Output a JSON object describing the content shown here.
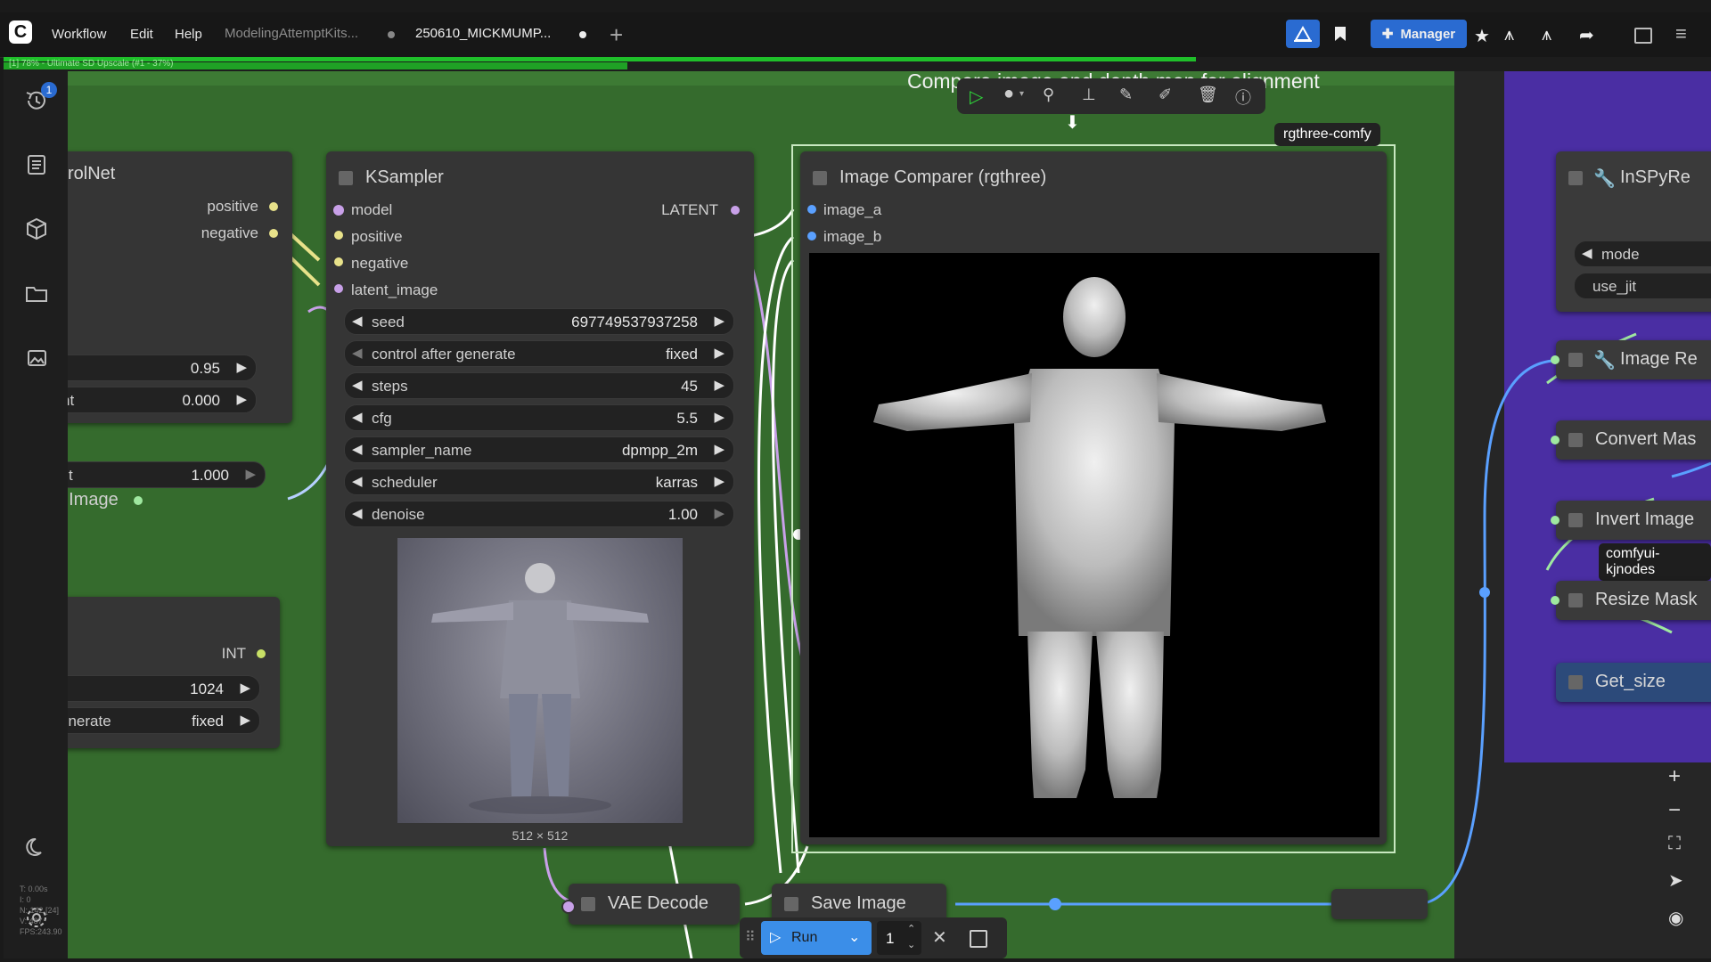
{
  "app": {
    "logo": "C",
    "menu": [
      "Workflow",
      "Edit",
      "Help"
    ],
    "tabs": [
      {
        "label": "ModelingAttemptKits...",
        "active": false
      },
      {
        "label": "250610_MICKMUMP...",
        "active": true
      }
    ],
    "progress_text": "[1] 78% - Ultimate SD Upscale (#1 - 37%)",
    "manager_label": "Manager",
    "accent": "#2a6bd1"
  },
  "sidebar": {
    "queue_badge": "1",
    "stats": [
      "T: 0.00s",
      "I: 0",
      "N: 142 [24]",
      "V: 487",
      "FPS:243.90"
    ]
  },
  "canvas": {
    "group_title": "Compare image and depth map for alignment",
    "group_source_badge": "rgthree-comfy",
    "controlnet_node": {
      "title": "rolNet",
      "outputs": [
        "positive",
        "negative"
      ],
      "widgets": [
        {
          "label": "",
          "value": "0.95"
        },
        {
          "label": "nt",
          "value": "0.000"
        },
        {
          "label": "t",
          "value": "1.000"
        }
      ],
      "input_label": "t Image"
    },
    "int_node": {
      "output": "INT",
      "widgets": [
        {
          "label": "",
          "value": "1024"
        },
        {
          "label": "enerate",
          "value": "fixed"
        }
      ]
    },
    "ksampler": {
      "title": "KSampler",
      "inputs": [
        "model",
        "positive",
        "negative",
        "latent_image"
      ],
      "output": "LATENT",
      "widgets": [
        {
          "label": "seed",
          "value": "697749537937258"
        },
        {
          "label": "control after generate",
          "value": "fixed"
        },
        {
          "label": "steps",
          "value": "45"
        },
        {
          "label": "cfg",
          "value": "5.5"
        },
        {
          "label": "sampler_name",
          "value": "dpmpp_2m"
        },
        {
          "label": "scheduler",
          "value": "karras"
        },
        {
          "label": "denoise",
          "value": "1.00"
        }
      ],
      "preview_size": "512 × 512"
    },
    "comparer": {
      "title": "Image Comparer (rgthree)",
      "inputs": [
        "image_a",
        "image_b"
      ]
    },
    "vae_decode": {
      "title": "VAE Decode"
    },
    "save_image": {
      "title": "Save Image"
    },
    "right_panel": {
      "nodes": [
        {
          "title": "InSPyRe",
          "icon": "wrench-icon"
        },
        {
          "title": "Image Re",
          "icon": "wrench-icon"
        },
        {
          "title": "Convert Mas",
          "icon": ""
        },
        {
          "title": "Invert Image",
          "icon": ""
        },
        {
          "title": "Resize Mask",
          "icon": ""
        },
        {
          "title": "Get_size",
          "icon": ""
        }
      ],
      "widgets": [
        "mode",
        "use_jit"
      ],
      "badge": "comfyui-kjnodes"
    }
  },
  "run_bar": {
    "run_label": "Run",
    "count": "1"
  }
}
